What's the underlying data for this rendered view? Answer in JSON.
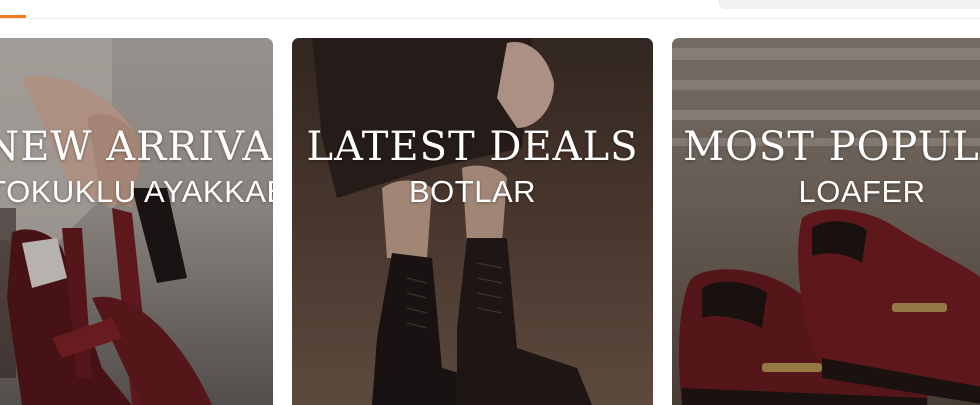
{
  "header": {
    "search_placeholder": ""
  },
  "promo_cards": [
    {
      "headline": "NEW ARRIVAL",
      "subline": "TOKUKLU AYAKKABI",
      "image": "red-strappy-heels-photo"
    },
    {
      "headline": "LATEST DEALS",
      "subline": "BOTLAR",
      "image": "black-lace-up-boots-photo"
    },
    {
      "headline": "MOST POPULAR",
      "subline": "LOAFER",
      "image": "burgundy-loafers-photo"
    }
  ],
  "colors": {
    "accent": "#f07a1a",
    "burgundy": "#6e1a1e",
    "boot_black": "#1a1614"
  }
}
